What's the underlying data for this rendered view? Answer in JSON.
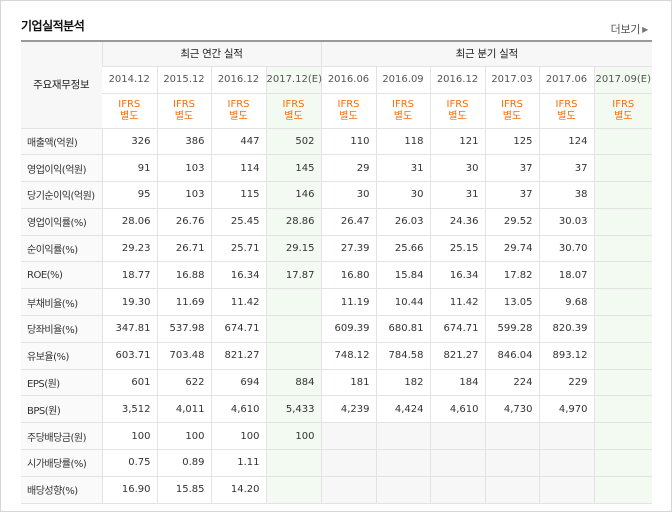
{
  "header": {
    "title": "기업실적분석",
    "more_label": "더보기"
  },
  "colors": {
    "ifrs": "#ff6a00",
    "estimate_bg": "#f3faf2",
    "header_bg": "#f7f7f7"
  },
  "table": {
    "row_header_label": "주요재무정보",
    "groups": [
      "최근 연간 실적",
      "최근 분기 실적"
    ],
    "periods": [
      "2014.12",
      "2015.12",
      "2016.12",
      "2017.12(E)",
      "2016.06",
      "2016.09",
      "2016.12",
      "2017.03",
      "2017.06",
      "2017.09(E)"
    ],
    "ifrs": [
      "IFRS",
      "별도"
    ],
    "rows": [
      {
        "label": "매출액(억원)",
        "values": [
          "326",
          "386",
          "447",
          "502",
          "110",
          "118",
          "121",
          "125",
          "124",
          ""
        ]
      },
      {
        "label": "영업이익(억원)",
        "values": [
          "91",
          "103",
          "114",
          "145",
          "29",
          "31",
          "30",
          "37",
          "37",
          ""
        ]
      },
      {
        "label": "당기순이익(억원)",
        "values": [
          "95",
          "103",
          "115",
          "146",
          "30",
          "30",
          "31",
          "37",
          "38",
          ""
        ]
      },
      {
        "label": "영업이익률(%)",
        "values": [
          "28.06",
          "26.76",
          "25.45",
          "28.86",
          "26.47",
          "26.03",
          "24.36",
          "29.52",
          "30.03",
          ""
        ]
      },
      {
        "label": "순이익률(%)",
        "values": [
          "29.23",
          "26.71",
          "25.71",
          "29.15",
          "27.39",
          "25.66",
          "25.15",
          "29.74",
          "30.70",
          ""
        ]
      },
      {
        "label": "ROE(%)",
        "values": [
          "18.77",
          "16.88",
          "16.34",
          "17.87",
          "16.80",
          "15.84",
          "16.34",
          "17.82",
          "18.07",
          ""
        ]
      },
      {
        "label": "부채비율(%)",
        "values": [
          "19.30",
          "11.69",
          "11.42",
          "",
          "11.19",
          "10.44",
          "11.42",
          "13.05",
          "9.68",
          ""
        ]
      },
      {
        "label": "당좌비율(%)",
        "values": [
          "347.81",
          "537.98",
          "674.71",
          "",
          "609.39",
          "680.81",
          "674.71",
          "599.28",
          "820.39",
          ""
        ]
      },
      {
        "label": "유보율(%)",
        "values": [
          "603.71",
          "703.48",
          "821.27",
          "",
          "748.12",
          "784.58",
          "821.27",
          "846.04",
          "893.12",
          ""
        ]
      },
      {
        "label": "EPS(원)",
        "values": [
          "601",
          "622",
          "694",
          "884",
          "181",
          "182",
          "184",
          "224",
          "229",
          ""
        ]
      },
      {
        "label": "BPS(원)",
        "values": [
          "3,512",
          "4,011",
          "4,610",
          "5,433",
          "4,239",
          "4,424",
          "4,610",
          "4,730",
          "4,970",
          ""
        ]
      },
      {
        "label": "주당배당금(원)",
        "values": [
          "100",
          "100",
          "100",
          "100",
          "",
          "",
          "",
          "",
          "",
          ""
        ]
      },
      {
        "label": "시가배당률(%)",
        "values": [
          "0.75",
          "0.89",
          "1.11",
          "",
          "",
          "",
          "",
          "",
          "",
          ""
        ]
      },
      {
        "label": "배당성향(%)",
        "values": [
          "16.90",
          "15.85",
          "14.20",
          "",
          "",
          "",
          "",
          "",
          "",
          ""
        ]
      }
    ]
  }
}
